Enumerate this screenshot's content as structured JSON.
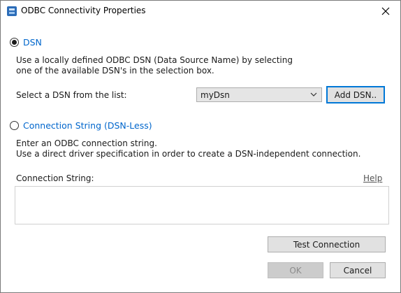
{
  "window": {
    "title": "ODBC Connectivity Properties",
    "close_glyph": "×"
  },
  "dsn_option": {
    "label": "DSN",
    "selected": true,
    "description_line1": "Use a locally defined ODBC DSN (Data Source Name) by selecting",
    "description_line2": "one of the available DSN's in the selection box.",
    "select_label": "Select a DSN from the list:",
    "selected_dsn": "myDsn",
    "add_button_label": "Add DSN.."
  },
  "conn_option": {
    "label": "Connection String (DSN-Less)",
    "selected": false,
    "description_line1": "Enter an ODBC connection string.",
    "description_line2": "Use a direct driver specification in order to create a DSN-independent connection.",
    "field_label": "Connection String:",
    "help_link": "Help",
    "field_value": ""
  },
  "buttons": {
    "test_connection": "Test Connection",
    "ok": "OK",
    "cancel": "Cancel"
  },
  "colors": {
    "accent": "#0066cc",
    "focus_border": "#0078d7"
  },
  "icons": [
    "app-icon",
    "close-icon",
    "radio-selected-icon",
    "radio-unselected-icon",
    "chevron-down-icon"
  ]
}
